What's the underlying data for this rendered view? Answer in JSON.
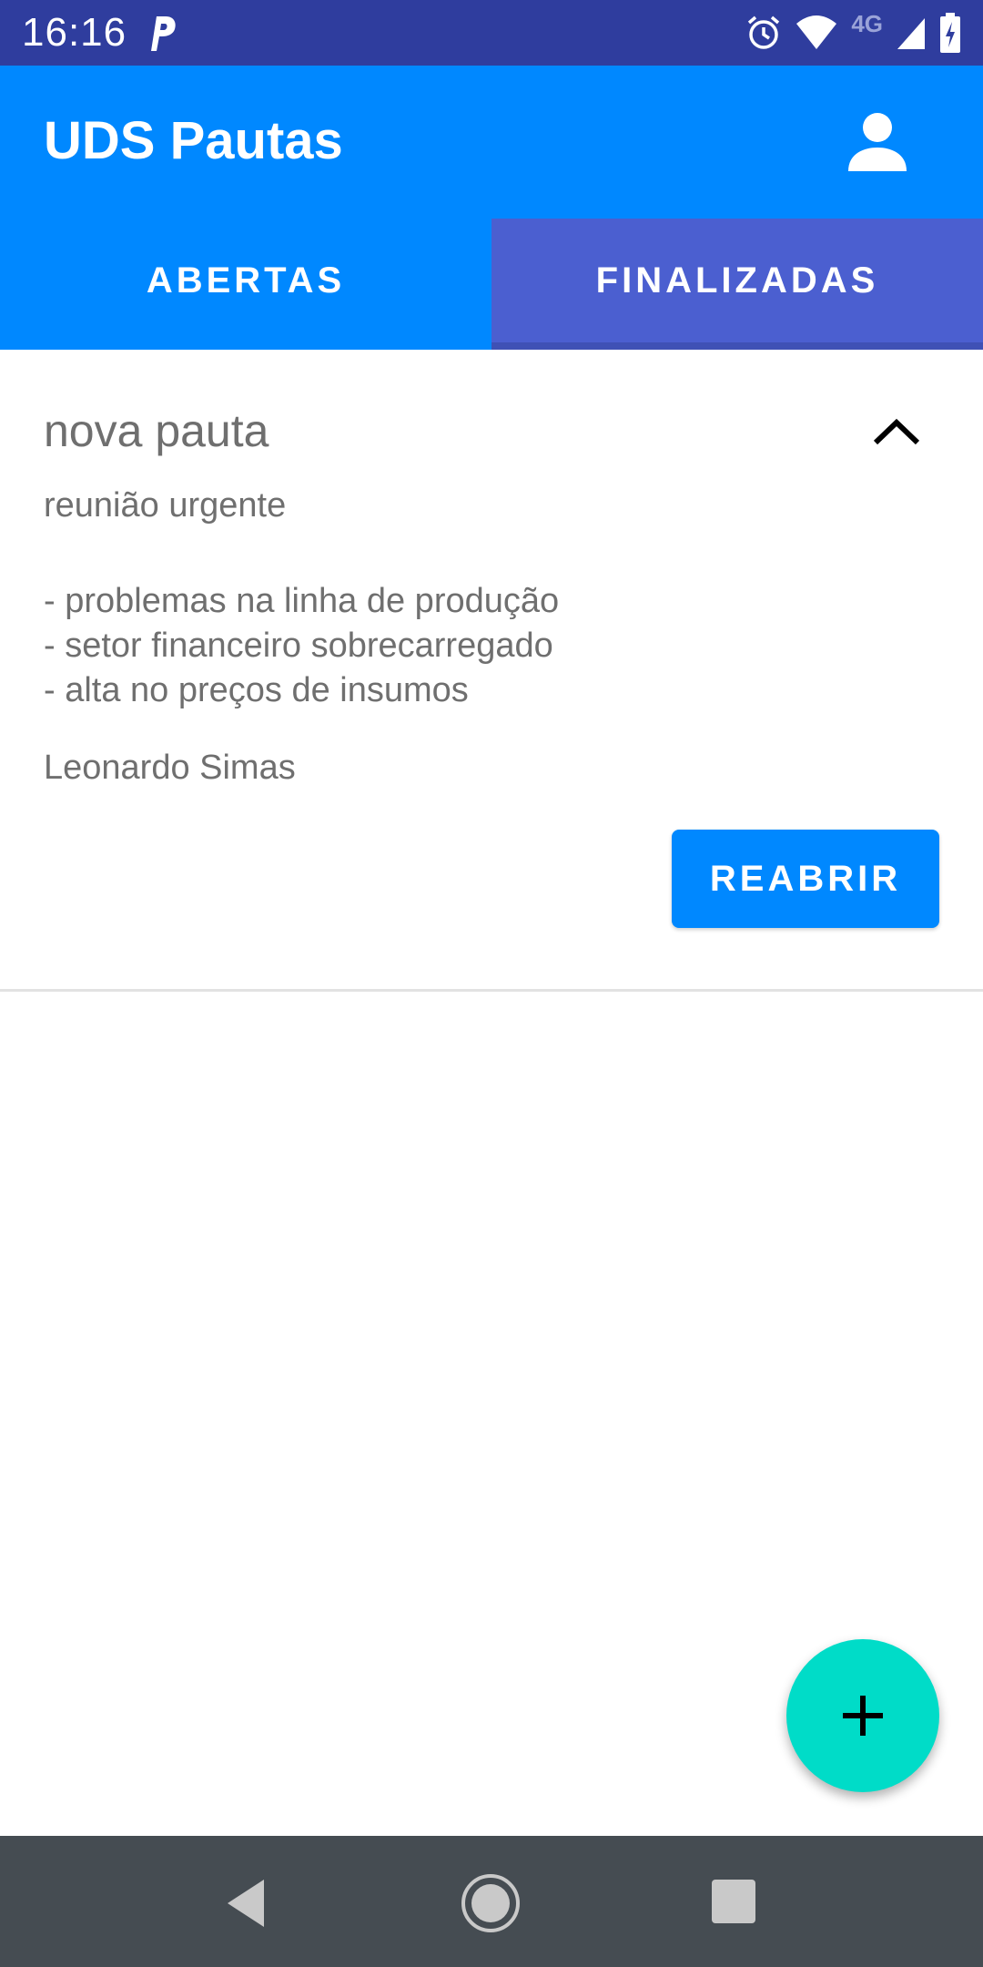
{
  "status_bar": {
    "time": "16:16",
    "network_label": "4G",
    "icons": [
      "parking-icon",
      "alarm-icon",
      "wifi-icon",
      "signal-icon",
      "battery-icon"
    ]
  },
  "app_bar": {
    "title": "UDS Pautas",
    "account_icon": "account-icon"
  },
  "tabs": [
    {
      "label": "ABERTAS",
      "selected": false
    },
    {
      "label": "FINALIZADAS",
      "selected": true
    }
  ],
  "pauta": {
    "title": "nova pauta",
    "subtitle": "reunião urgente",
    "description_lines": [
      "- problemas na linha de produção",
      "- setor financeiro sobrecarregado",
      "- alta no preços de insumos"
    ],
    "author": "Leonardo Simas",
    "action_label": "REABRIR",
    "expanded": true
  },
  "fab": {
    "icon": "plus-icon"
  },
  "nav_bar": {
    "icons": [
      "back-icon",
      "home-icon",
      "recent-apps-icon"
    ]
  },
  "colors": {
    "primary": "#0088FF",
    "status_bar": "#2F3D9E",
    "tab_selected": "#4B5FD0",
    "fab": "#00DCC8",
    "nav_bar": "#454C52"
  }
}
